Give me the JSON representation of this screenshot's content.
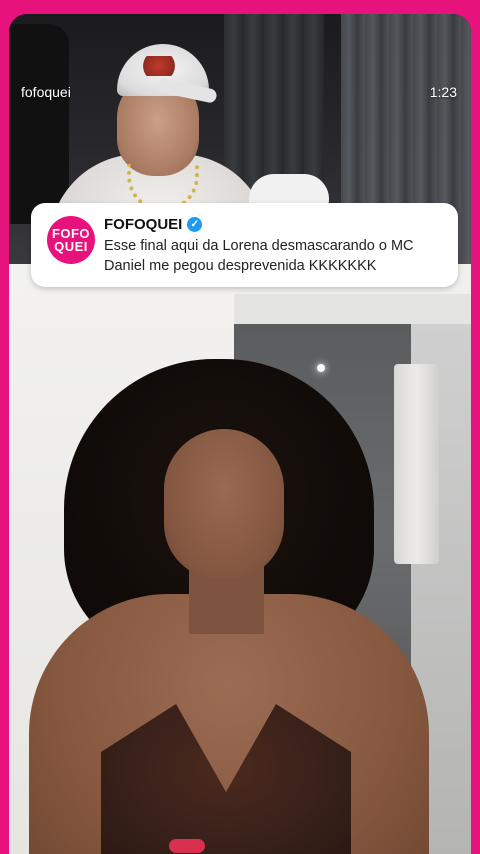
{
  "overlay": {
    "username": "fofoquei",
    "time": "1:23"
  },
  "tweet": {
    "avatar_text_line1": "FOFO",
    "avatar_text_line2": "QUEI",
    "name": "FOFOQUEI",
    "verified_icon": "check",
    "text": "Esse final aqui da Lorena desmascarando o MC Daniel me pegou desprevenida KKKKKKK"
  },
  "colors": {
    "brand": "#e8127c",
    "verified": "#1d9bf0"
  }
}
